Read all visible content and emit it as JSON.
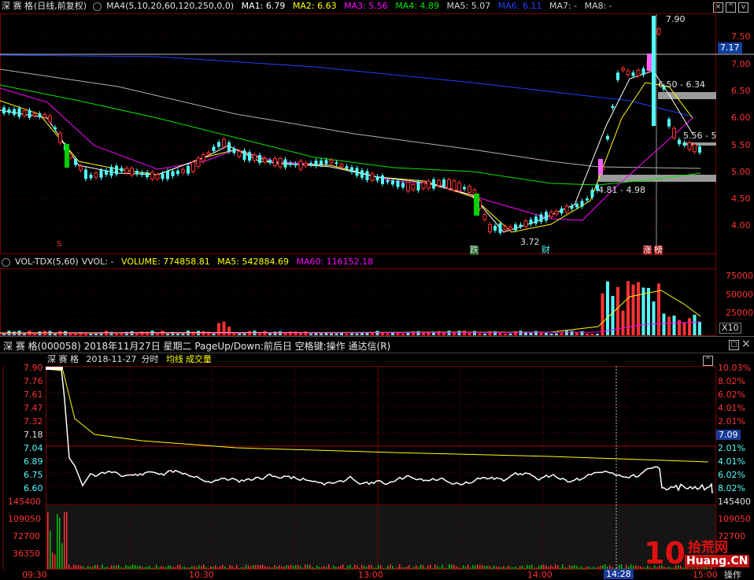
{
  "kline": {
    "legend": {
      "name": "深 赛 格",
      "mode": "(日线,前复权)",
      "ma_group": "MA4(5,10,20,60,120,250,0,0)",
      "ma1": "MA1: 6.79",
      "ma2": "MA2: 6.63",
      "ma3": "MA3: 5.56",
      "ma4": "MA4: 4.89",
      "ma5": "MA5: 5.07",
      "ma6": "MA6: 6.11",
      "ma7": "MA7: -",
      "ma8": "MA8: -"
    },
    "price_ticks": [
      "7.50",
      "7.00",
      "6.50",
      "6.00",
      "5.50",
      "5.00",
      "4.50",
      "4.00"
    ],
    "current_price_badge": "7.17",
    "annotations": {
      "high": "7.90",
      "low": "3.72",
      "range_upper": "6.50 - 6.34",
      "range_lower": "4.81 - 4.98",
      "side_value": "5.56 - 5"
    },
    "markers": {
      "s_mark": "S",
      "die": "跌",
      "cai": "财",
      "zhang": "涨",
      "bang": "榜"
    }
  },
  "volume": {
    "legend": {
      "name": "VOL-TDX(5,60)",
      "vvol": "VVOL: -",
      "volume": "VOLUME: 774858.81",
      "ma5": "MA5: 542884.69",
      "ma60": "MA60: 116152.18"
    },
    "ticks": [
      "75000",
      "50000",
      "25000"
    ],
    "unit": "X10"
  },
  "intraday_window": {
    "title": "深 赛 格(000058)  2018年11月27日 星期二  PageUp/Down:前后日  空格键:操作  通达信(R)"
  },
  "intraday": {
    "legend": {
      "name": "深 赛 格",
      "date": "2018-11-27",
      "type": "分时",
      "avg": "均线",
      "vol": "成交量"
    },
    "left_ticks": [
      "7.90",
      "7.76",
      "7.61",
      "7.47",
      "7.32",
      "7.18",
      "7.04",
      "6.89",
      "6.75",
      "6.60"
    ],
    "right_ticks": [
      "10.03%",
      "8.02%",
      "6.02%",
      "4.01%",
      "2.01%",
      "2.01%",
      "4.01%",
      "6.02%",
      "8.02%"
    ],
    "right_badge": "7.09",
    "vol_left_ticks": [
      "145400",
      "109050",
      "72700",
      "36350"
    ],
    "vol_right_ticks": [
      "145400",
      "109050",
      "72700"
    ],
    "time_ticks": [
      "09:30",
      "10:30",
      "13:00",
      "14:00",
      "15:00"
    ],
    "cursor_time": "14:28",
    "action_label": "操作"
  },
  "watermark": {
    "num": "10",
    "cn": "拾荒网",
    "en": "Huang.CN"
  },
  "colors": {
    "up": "#ff3232",
    "down": "#54fcfc",
    "ma1": "#ffffff",
    "ma2": "#ffff00",
    "ma3": "#ff00ff",
    "ma4": "#00e600",
    "ma5": "#b0b0b0",
    "ma6": "#2040ff",
    "grid": "#7a0000"
  }
}
